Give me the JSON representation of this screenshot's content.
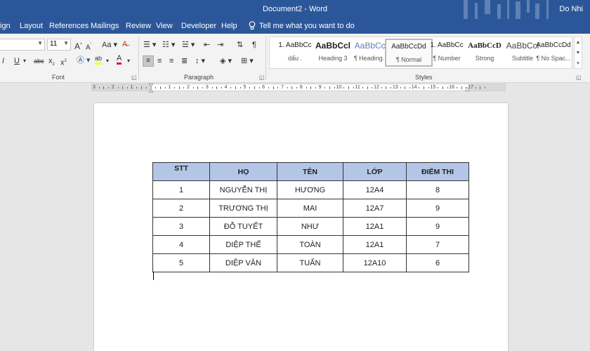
{
  "window": {
    "title": "Document2  -  Word",
    "user": "Do Nhi"
  },
  "tabs": [
    "ign",
    "Layout",
    "References",
    "Mailings",
    "Review",
    "View",
    "Developer",
    "Help"
  ],
  "tell_me": "Tell me what you want to do",
  "font": {
    "name": "",
    "size": "11",
    "group_label": "Font"
  },
  "paragraph": {
    "group_label": "Paragraph"
  },
  "styles": {
    "group_label": "Styles",
    "items": [
      {
        "sample": "1.  AaBbCc",
        "name": "dấu ."
      },
      {
        "sample": "AaBbCcl",
        "name": "Heading 3"
      },
      {
        "sample": "AaBbCcl",
        "name": "¶ Heading..."
      },
      {
        "sample": "AaBbCcDd",
        "name": "¶ Normal"
      },
      {
        "sample": "1.  AaBbCc",
        "name": "¶ Number"
      },
      {
        "sample": "AaBbCcD",
        "name": "Strong"
      },
      {
        "sample": "AaBbCcl",
        "name": "Subtitle"
      },
      {
        "sample": "AaBbCcDd",
        "name": "¶ No Spac..."
      }
    ]
  },
  "ruler": {
    "numbers": [
      "3",
      "2",
      "1",
      "",
      "1",
      "2",
      "3",
      "4",
      "5",
      "6",
      "7",
      "8",
      "9",
      "10",
      "11",
      "12",
      "13",
      "14",
      "15",
      "16",
      "17"
    ]
  },
  "table": {
    "headers": [
      "STT",
      "HỌ",
      "TÊN",
      "LỚP",
      "ĐIỂM THI"
    ],
    "rows": [
      [
        "1",
        "NGUYỄN THỊ",
        "HƯƠNG",
        "12A4",
        "8"
      ],
      [
        "2",
        "TRƯƠNG THỊ",
        "MAI",
        "12A7",
        "9"
      ],
      [
        "3",
        "ĐỖ TUYẾT",
        "NHƯ",
        "12A1",
        "9"
      ],
      [
        "4",
        "DIỆP THẾ",
        "TOÀN",
        "12A1",
        "7"
      ],
      [
        "5",
        "DIỆP VĂN",
        "TUẤN",
        "12A10",
        "6"
      ]
    ]
  }
}
